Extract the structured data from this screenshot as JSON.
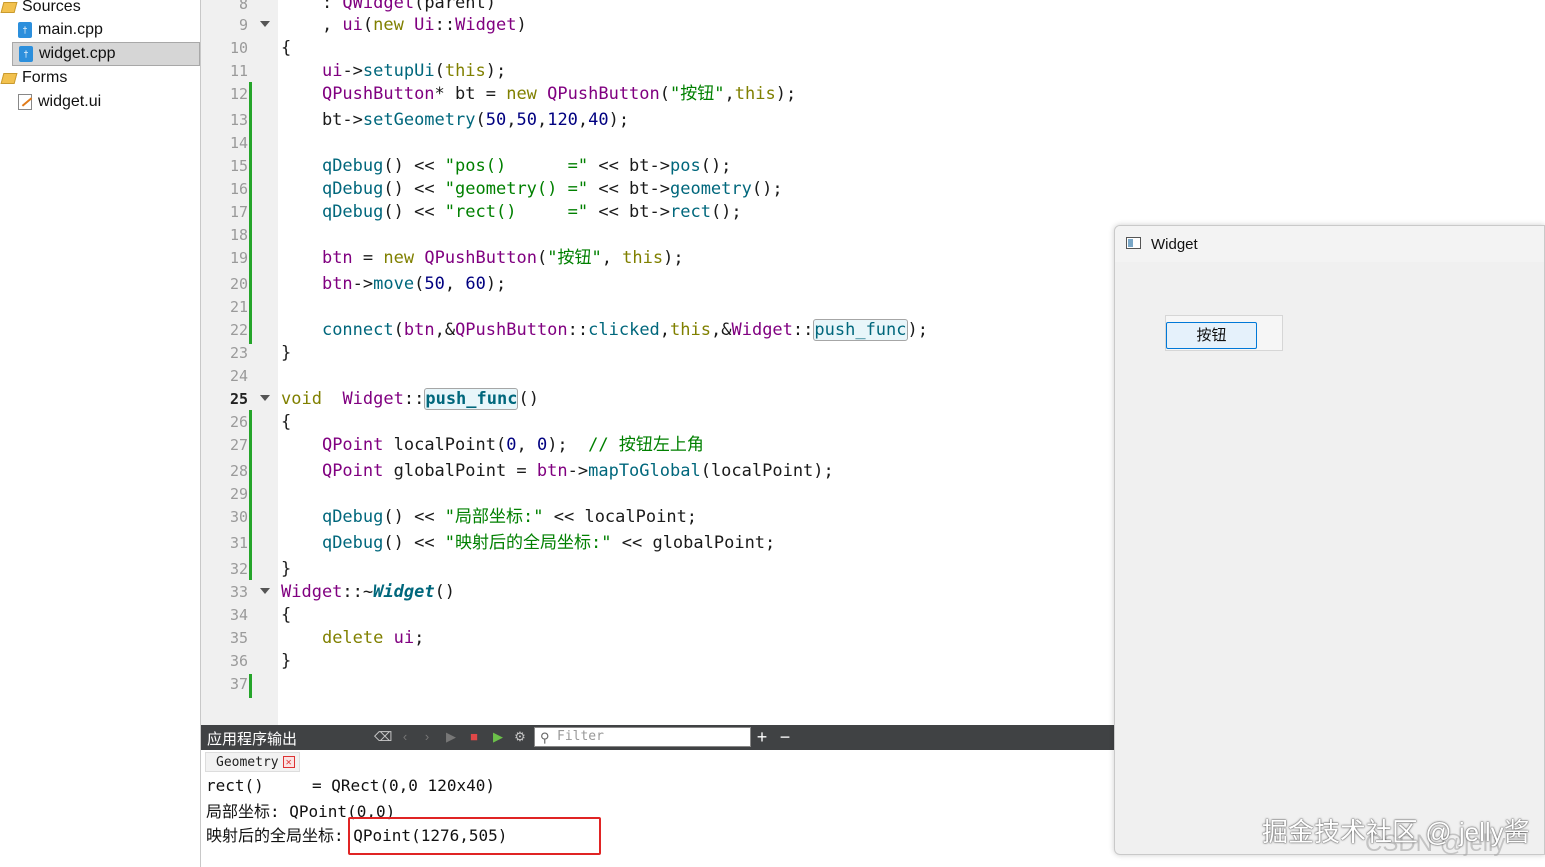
{
  "project_tree": {
    "items": [
      {
        "label": "Sources",
        "kind": "folder"
      },
      {
        "label": "main.cpp",
        "kind": "file"
      },
      {
        "label": "widget.cpp",
        "kind": "file",
        "selected": true
      },
      {
        "label": "Forms",
        "kind": "folder"
      },
      {
        "label": "widget.ui",
        "kind": "ui"
      }
    ]
  },
  "editor": {
    "current_line": "25",
    "line_numbers": [
      "8",
      "9",
      "10",
      "11",
      "12",
      "13",
      "14",
      "15",
      "16",
      "17",
      "18",
      "19",
      "20",
      "21",
      "22",
      "23",
      "24",
      "25",
      "26",
      "27",
      "28",
      "29",
      "30",
      "31",
      "32",
      "33",
      "34",
      "35",
      "36",
      "37"
    ],
    "lines": {
      "l8": ": QWidget(parent)",
      "l9": ", ui(new Ui::Widget)",
      "l10": "{",
      "l11": "ui->setupUi(this);",
      "l12": "QPushButton* bt = new QPushButton(\"按钮\",this);",
      "l13": "bt->setGeometry(50,50,120,40);",
      "l15": "qDebug() << \"pos()      =\" << bt->pos();",
      "l16": "qDebug() << \"geometry() =\" << bt->geometry();",
      "l17": "qDebug() << \"rect()     =\" << bt->rect();",
      "l19": "btn = new QPushButton(\"按钮\", this);",
      "l20": "btn->move(50, 60);",
      "l22": "connect(btn,&QPushButton::clicked,this,&Widget::push_func);",
      "l23": "}",
      "l25": "void  Widget::push_func()",
      "l26": "{",
      "l27": "QPoint localPoint(0, 0);  // 按钮左上角",
      "l28": "QPoint globalPoint = btn->mapToGlobal(localPoint);",
      "l30": "qDebug() << \"局部坐标:\" << localPoint;",
      "l31": "qDebug() << \"映射后的全局坐标:\" << globalPoint;",
      "l32": "}",
      "l33": "Widget::~Widget()",
      "l34": "{",
      "l35": "delete ui;",
      "l36": "}"
    }
  },
  "output": {
    "title": "应用程序输出",
    "filter_placeholder": "Filter",
    "tab_label": "Geometry",
    "lines": [
      "rect()     = QRect(0,0 120x40)",
      "局部坐标: QPoint(0,0)",
      "映射后的全局坐标: QPoint(1276,505)"
    ]
  },
  "widget_window": {
    "title": "Widget",
    "button_label": "按钮"
  },
  "watermark": {
    "line1": "掘金技术社区 @ jelly酱",
    "line2": "CSDN @jelly"
  },
  "colors": {
    "keyword": "#808000",
    "type": "#800080",
    "function": "#00677c",
    "string": "#008000",
    "highlight_box": "#e02424",
    "output_toolbar": "#404244"
  }
}
